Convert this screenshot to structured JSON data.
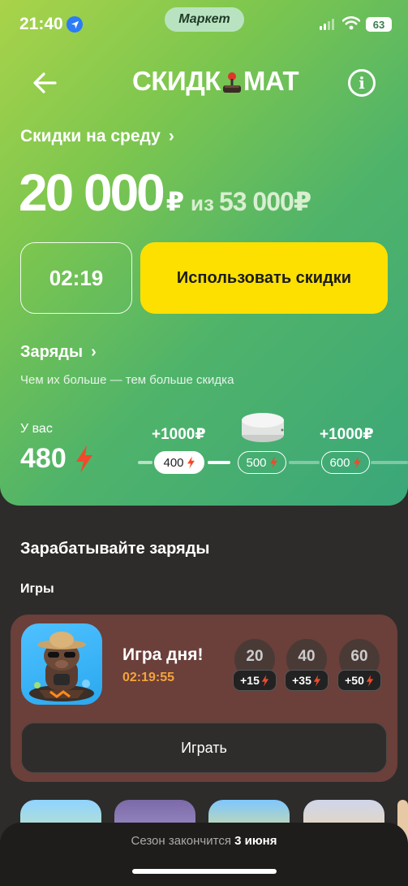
{
  "status_bar": {
    "time": "21:40",
    "app_pill": "Маркет",
    "battery": "63"
  },
  "header": {
    "logo_left": "СКИДК",
    "logo_right": "МАТ",
    "info": "i"
  },
  "discount": {
    "link": "Скидки на среду",
    "amount": "20 000",
    "currency": "₽",
    "of": "из",
    "total": "53 000₽",
    "timer": "02:19",
    "use_button": "Использовать скидки"
  },
  "charges": {
    "link": "Заряды",
    "subtitle": "Чем их больше — тем больше скидка",
    "you_have_label": "У вас",
    "you_have_value": "480",
    "milestones": [
      {
        "value": "400",
        "bonus": "+1000₽"
      },
      {
        "value": "500",
        "bonus": ""
      },
      {
        "value": "600",
        "bonus": "+1000₽"
      }
    ]
  },
  "earn": {
    "title": "Зарабатывайте заряды",
    "games_label": "Игры",
    "game": {
      "name": "Игра дня!",
      "timer": "02:19:55",
      "levels": [
        {
          "score": "20",
          "reward": "+15"
        },
        {
          "score": "40",
          "reward": "+35"
        },
        {
          "score": "60",
          "reward": "+50"
        }
      ],
      "play_button": "Играть"
    }
  },
  "footer": {
    "season_text": "Сезон закончится",
    "season_date": "3 июня"
  },
  "colors": {
    "accent_yellow": "#fde000",
    "bolt_red": "#f04a2a",
    "timer_orange": "#f4a43a",
    "card_brown": "#6b3f3a"
  },
  "icons": [
    "location-arrow-icon",
    "signal-icon",
    "wifi-icon",
    "battery-icon",
    "back-arrow-icon",
    "joystick-icon",
    "info-icon",
    "chevron-right-icon",
    "lightning-bolt-icon",
    "game-button-icon"
  ]
}
